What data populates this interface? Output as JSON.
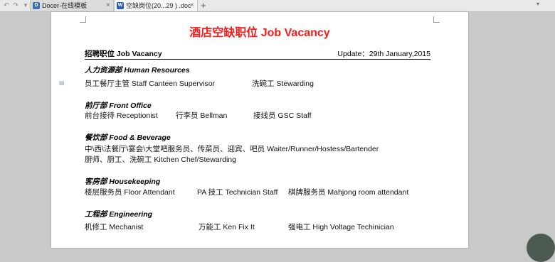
{
  "tabs": [
    {
      "label": "Docer-在线模板",
      "icon": "docer-icon",
      "icon_color": "#3b6fb6"
    },
    {
      "label": "空缺岗位(20...29 ) .doc",
      "icon": "word-doc-icon",
      "icon_color": "#2a5db0"
    }
  ],
  "new_tab_label": "+",
  "document": {
    "title": "酒店空缺职位 Job Vacancy",
    "header_left": "招聘职位 Job Vacancy",
    "header_right": "Update：29th January,2015",
    "departments": [
      {
        "name": "人力资源部 Human Resources",
        "lines": [
          [
            "员工餐厅主管 Staff Canteen Supervisor",
            "洗碗工 Stewarding"
          ]
        ]
      },
      {
        "name": "前厅部 Front Office",
        "lines": [
          [
            "前台接待 Receptionist",
            "行李员 Bellman",
            "接线员 GSC Staff"
          ]
        ]
      },
      {
        "name": "餐饮部 Food & Beverage",
        "lines": [
          [
            "中\\西\\法餐厅\\宴会\\大堂吧服务员、传菜员、迎宾、吧员 Waiter/Runner/Hostess/Bartender"
          ],
          [
            "厨师、厨工、洗碗工 Kitchen Chef/Stewarding"
          ]
        ]
      },
      {
        "name": "客房部 Housekeeping",
        "lines": [
          [
            "楼层服务员 Floor Attendant",
            "PA 技工 Technician Staff",
            "棋牌服务员 Mahjong room attendant"
          ]
        ]
      },
      {
        "name": "工程部 Engineering",
        "lines": [
          [
            "机修工 Mechanist",
            "万能工 Ken Fix It",
            "强电工 High Voltage Techinician"
          ]
        ]
      }
    ]
  },
  "colors": {
    "title": "#ff1a1a",
    "accent": "#2f7cd1"
  }
}
